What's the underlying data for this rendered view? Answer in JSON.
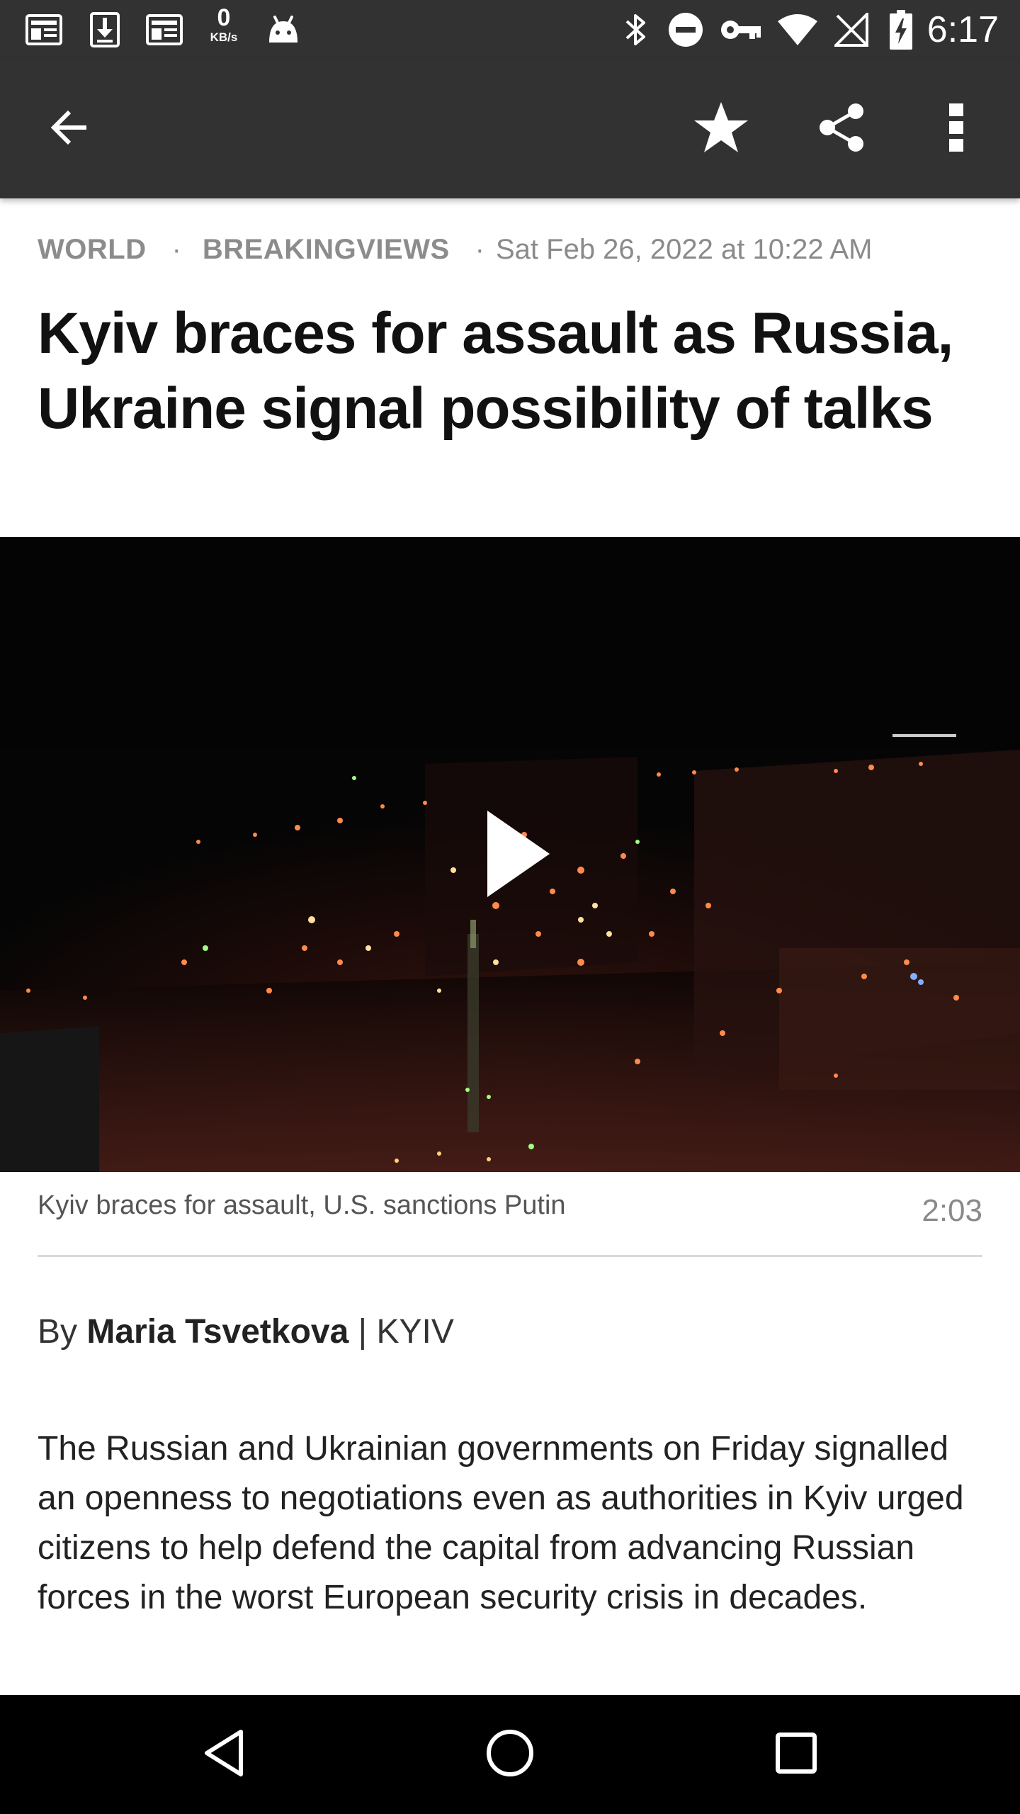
{
  "status_bar": {
    "network_speed_value": "0",
    "network_speed_unit": "KB/s",
    "time": "6:17",
    "left_icons": [
      "news-icon",
      "download-icon",
      "news-icon",
      "speed-icon",
      "android-icon"
    ],
    "right_icons": [
      "bluetooth-icon",
      "do-not-disturb-icon",
      "vpn-key-icon",
      "wifi-icon",
      "no-sim-icon",
      "battery-charging-icon"
    ]
  },
  "app_bar": {
    "back_icon": "arrow-back-icon",
    "actions": [
      "star-icon",
      "share-icon",
      "more-vert-icon"
    ]
  },
  "article": {
    "section": "WORLD",
    "category": "BREAKINGVIEWS",
    "separator": "·",
    "date": "Sat Feb 26, 2022 at 10:22 AM",
    "headline": "Kyiv braces for assault as Russia, Ukraine signal possibility of talks",
    "video": {
      "caption": "Kyiv braces for assault, U.S. sanctions Putin",
      "duration": "2:03",
      "play_icon": "play-icon"
    },
    "byline_prefix": "By ",
    "author": "Maria Tsvetkova",
    "location": " | KYIV",
    "body": "The Russian and Ukrainian governments on Friday signalled an openness to negotiations even as authorities in Kyiv urged citizens to help defend the capital from advancing Russian forces in the worst European security crisis in decades."
  },
  "nav_bar": {
    "buttons": [
      "back-triangle-icon",
      "home-circle-icon",
      "recents-square-icon"
    ]
  },
  "colors": {
    "app_bar": "#323232",
    "meta_text": "#8a8a8a",
    "headline": "#111111",
    "nav_bar": "#000000"
  }
}
